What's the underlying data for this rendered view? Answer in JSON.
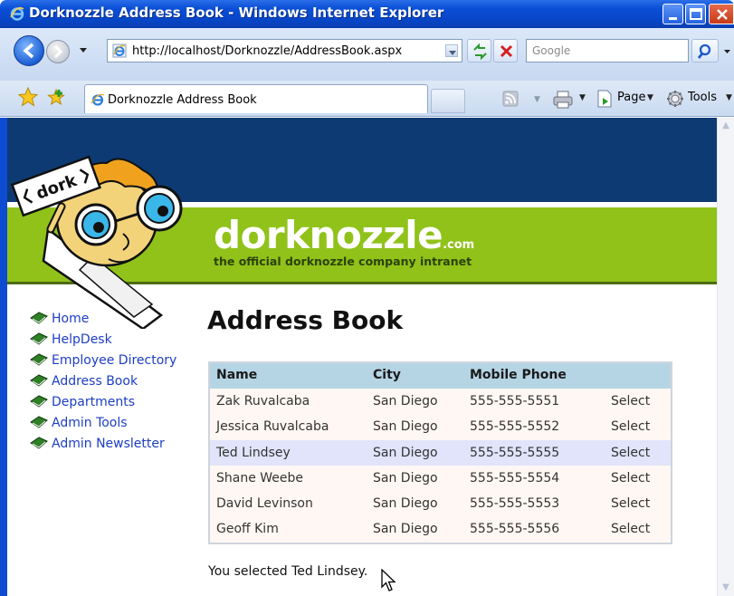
{
  "window": {
    "title": "Dorknozzle Address Book - Windows Internet Explorer"
  },
  "address_bar": {
    "url": "http://localhost/Dorknozzle/AddressBook.aspx",
    "search_placeholder": "Google"
  },
  "tabs": {
    "active_label": "Dorknozzle Address Book"
  },
  "command_bar": {
    "page_label": "Page",
    "tools_label": "Tools"
  },
  "site": {
    "brand": "dorknozzle",
    "brand_suffix": ".com",
    "tagline": "the official dorknozzle company intranet",
    "mascot_sign": "dork",
    "colors": {
      "header_blue": "#0d3a72",
      "header_green": "#90c21a",
      "link_blue": "#1d3ec4"
    }
  },
  "nav": [
    {
      "label": "Home"
    },
    {
      "label": "HelpDesk"
    },
    {
      "label": "Employee Directory"
    },
    {
      "label": "Address Book"
    },
    {
      "label": "Departments"
    },
    {
      "label": "Admin Tools"
    },
    {
      "label": "Admin Newsletter"
    }
  ],
  "main": {
    "title": "Address Book",
    "columns": [
      "Name",
      "City",
      "Mobile Phone"
    ],
    "rows": [
      {
        "name": "Zak Ruvalcaba",
        "city": "San Diego",
        "phone": "555-555-5551",
        "action": "Select"
      },
      {
        "name": "Jessica Ruvalcaba",
        "city": "San Diego",
        "phone": "555-555-5552",
        "action": "Select"
      },
      {
        "name": "Ted Lindsey",
        "city": "San Diego",
        "phone": "555-555-5555",
        "action": "Select"
      },
      {
        "name": "Shane Weebe",
        "city": "San Diego",
        "phone": "555-555-5554",
        "action": "Select"
      },
      {
        "name": "David Levinson",
        "city": "San Diego",
        "phone": "555-555-5553",
        "action": "Select"
      },
      {
        "name": "Geoff Kim",
        "city": "San Diego",
        "phone": "555-555-5556",
        "action": "Select"
      }
    ],
    "status_message": "You selected Ted Lindsey."
  }
}
